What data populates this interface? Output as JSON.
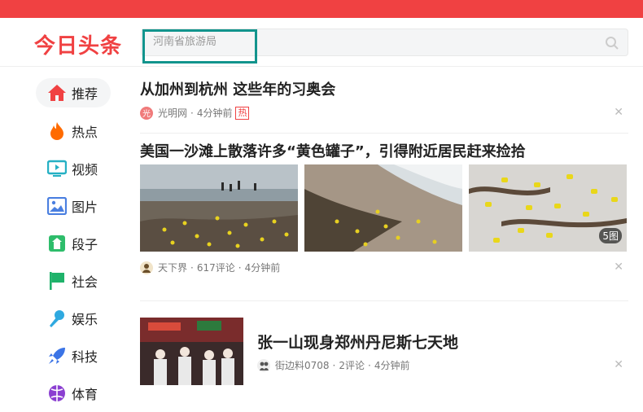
{
  "app": {
    "logo": "今日头条"
  },
  "search": {
    "placeholder": "河南省旅游局"
  },
  "sidebar": {
    "items": [
      {
        "label": "推荐",
        "icon": "home-icon",
        "active": true,
        "color": "#f04142"
      },
      {
        "label": "热点",
        "icon": "flame-icon",
        "color": "#ff6b00"
      },
      {
        "label": "视频",
        "icon": "video-icon",
        "color": "#25b0c4"
      },
      {
        "label": "图片",
        "icon": "image-icon",
        "color": "#4a7fe0"
      },
      {
        "label": "段子",
        "icon": "jokes-icon",
        "color": "#2ebd6b"
      },
      {
        "label": "社会",
        "icon": "flag-icon",
        "color": "#1fb26a"
      },
      {
        "label": "娱乐",
        "icon": "microphone-icon",
        "color": "#2fa9e0"
      },
      {
        "label": "科技",
        "icon": "rocket-icon",
        "color": "#3b74e6"
      },
      {
        "label": "体育",
        "icon": "sports-icon",
        "color": "#8b3fd1"
      }
    ]
  },
  "feed": {
    "articles": [
      {
        "title": "从加州到杭州 这些年的习奥会",
        "source": "光明网",
        "avatar_char": "光",
        "time": "4分钟前",
        "tag": "热"
      },
      {
        "title": "美国一沙滩上散落许多“黄色罐子”，引得附近居民赶来捡拾",
        "source": "天下界",
        "comments": "617评论",
        "time": "4分钟前",
        "image_count": "5图"
      },
      {
        "title": "张一山现身郑州丹尼斯七天地",
        "source": "街边料0708",
        "comments": "2评论",
        "time": "4分钟前"
      }
    ],
    "separator": "·",
    "close_label": "✕"
  },
  "colors": {
    "brand": "#f04142",
    "highlight_box": "#12948d"
  }
}
